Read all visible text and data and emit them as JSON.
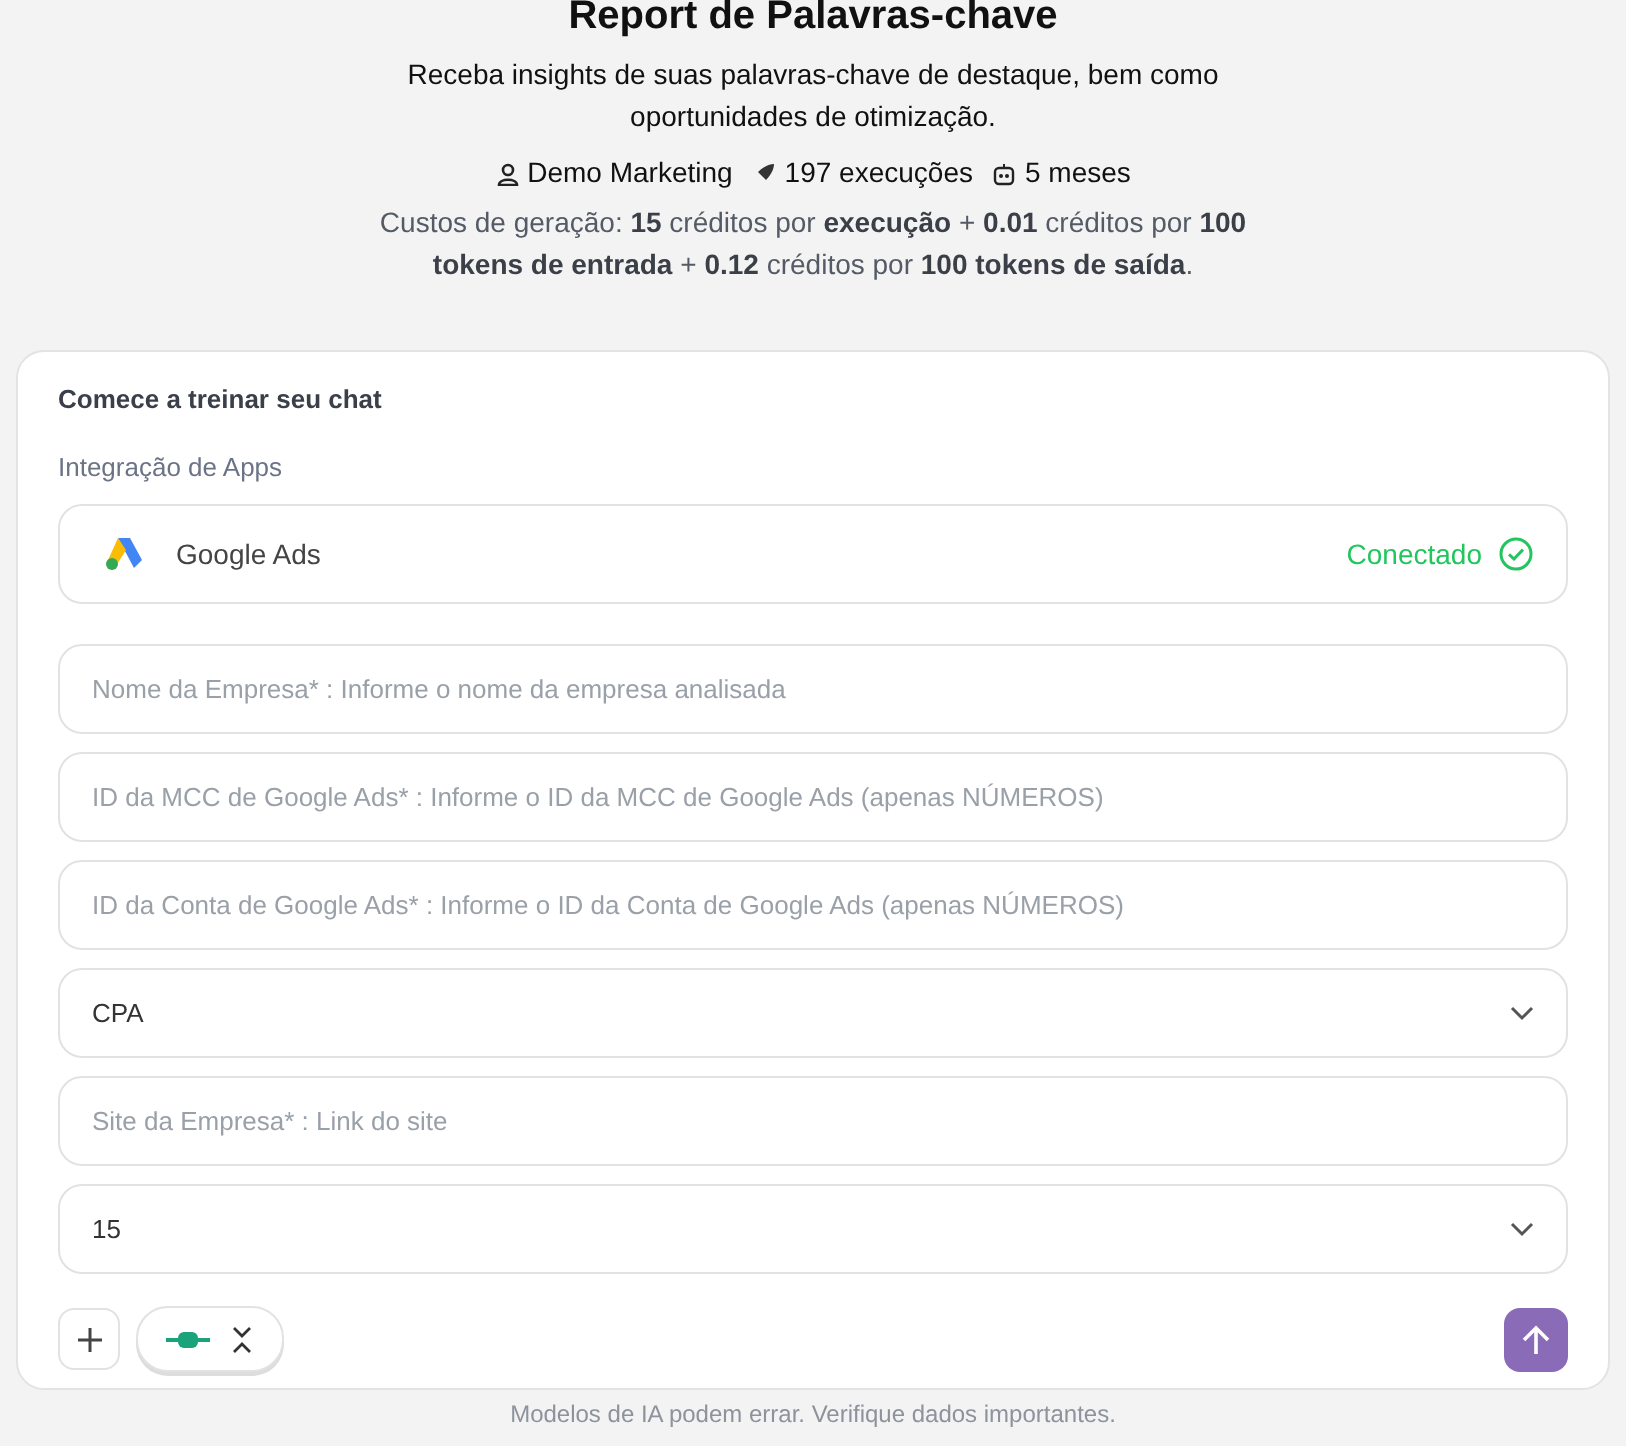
{
  "header": {
    "title": "Report de Palavras-chave",
    "description": "Receba insights de suas palavras-chave de destaque, bem como oportunidades de otimização.",
    "meta": [
      {
        "kind": "author",
        "text": "Demo Marketing"
      },
      {
        "kind": "runs",
        "text": "197 execuções"
      },
      {
        "kind": "age",
        "text": "5 meses"
      }
    ],
    "costs": "Custos de geração: **15** créditos por **execução** + **0.01** créditos por **100 tokens de entrada** + **0.12** créditos por **100 tokens de saída**."
  },
  "chat": {
    "heading": "Comece a treinar seu chat",
    "section_label": "Integração de Apps",
    "integration": {
      "name": "Google Ads",
      "status": "Conectado",
      "connected": true
    },
    "fields": [
      {
        "kind": "text",
        "placeholder": "Nome da Empresa* : Informe o nome da empresa analisada"
      },
      {
        "kind": "text",
        "placeholder": "ID da MCC de Google Ads* : Informe o ID da MCC de Google Ads (apenas NÚMEROS)"
      },
      {
        "kind": "text",
        "placeholder": "ID da Conta de Google Ads* : Informe o ID da Conta de Google Ads (apenas NÚMEROS)"
      },
      {
        "kind": "select",
        "value": "CPA"
      },
      {
        "kind": "text",
        "placeholder": "Site da Empresa* : Link do site"
      },
      {
        "kind": "select",
        "value": "15"
      }
    ]
  },
  "footer": {
    "disclaimer": "Modelos de IA podem errar. Verifique dados importantes."
  }
}
